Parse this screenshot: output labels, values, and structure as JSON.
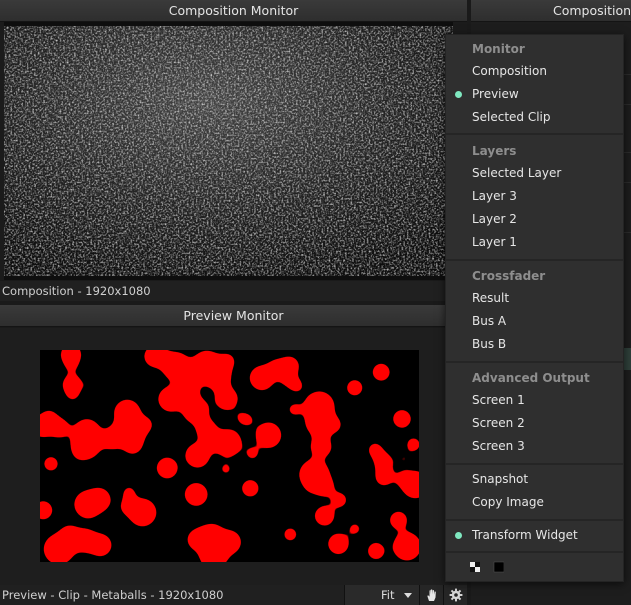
{
  "composition_monitor": {
    "title": "Composition Monitor",
    "status": "Composition - 1920x1080"
  },
  "right_panel": {
    "title": "Composition"
  },
  "preview_monitor": {
    "title": "Preview Monitor",
    "status": "Preview - Clip - Metaballs - 1920x1080",
    "fit_label": "Fit"
  },
  "menu": {
    "monitor_header": "Monitor",
    "monitor_items": [
      "Composition",
      "Preview",
      "Selected Clip"
    ],
    "layers_header": "Layers",
    "layers_items": [
      "Selected Layer",
      "Layer 3",
      "Layer 2",
      "Layer 1"
    ],
    "crossfader_header": "Crossfader",
    "crossfader_items": [
      "Result",
      "Bus A",
      "Bus B"
    ],
    "advanced_header": "Advanced Output",
    "advanced_items": [
      "Screen 1",
      "Screen 2",
      "Screen 3"
    ],
    "snapshot": "Snapshot",
    "copy_image": "Copy Image",
    "transform_widget": "Transform Widget",
    "selected_monitor": "Preview",
    "transform_widget_enabled": true
  },
  "colors": {
    "accent_dot": "#7fe8c0",
    "metaball_red": "#ff0000"
  }
}
